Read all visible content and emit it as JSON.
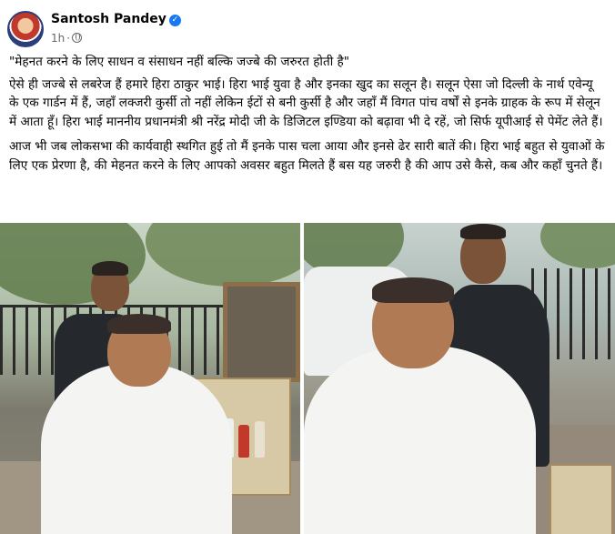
{
  "post": {
    "author": "Santosh Pandey",
    "verified_icon": "verified-badge-icon",
    "time": "1h",
    "privacy_icon": "globe-icon",
    "paragraphs": [
      "\"मेहनत करने के लिए साधन व संसाधन नहीं बल्कि जज्बे की जरुरत होती है\"",
      "ऐसे ही जज्बे से लबरेज हैं हमारे हिरा ठाकुर भाई। हिरा भाई युवा है और इनका खुद का सलून है। सलून ऐसा जो दिल्ली के नार्थ एवेन्यू के एक गार्डन में हैं, जहाँ लक्जरी कुर्सी तो नहीं लेकिन ईटों से बनी कुर्सी है और जहाँ मैं विगत पांच वर्षों से इनके ग्राहक के रूप में सेलून में आता हूँ। हिरा भाई माननीय प्रधानमंत्री श्री नरेंद्र मोदी जी के डिजिटल इण्डिया को बढ़ावा भी दे रहें, जो सिर्फ यूपीआई से पेमेंट लेते हैं।",
      "आज भी जब लोकसभा की कार्यवाही स्थगित हुई तो मैं इनके पास चला आया और इनसे ढेर सारी बातें की। हिरा भाई बहुत से युवाओं के लिए एक प्रेरणा है, की मेहनत करने के लिए आपको अवसर बहुत मिलते हैं बस यह जरुरी है की आप उसे कैसे, कब और कहाँ चुनते हैं।"
    ]
  },
  "colors": {
    "text": "#050505",
    "secondary_text": "#65676b",
    "verified": "#1877f2",
    "background": "#ffffff"
  },
  "photos": {
    "left_icon": "photo-barber-trimming-hair",
    "right_icon": "photo-barber-trimming-moustache"
  }
}
